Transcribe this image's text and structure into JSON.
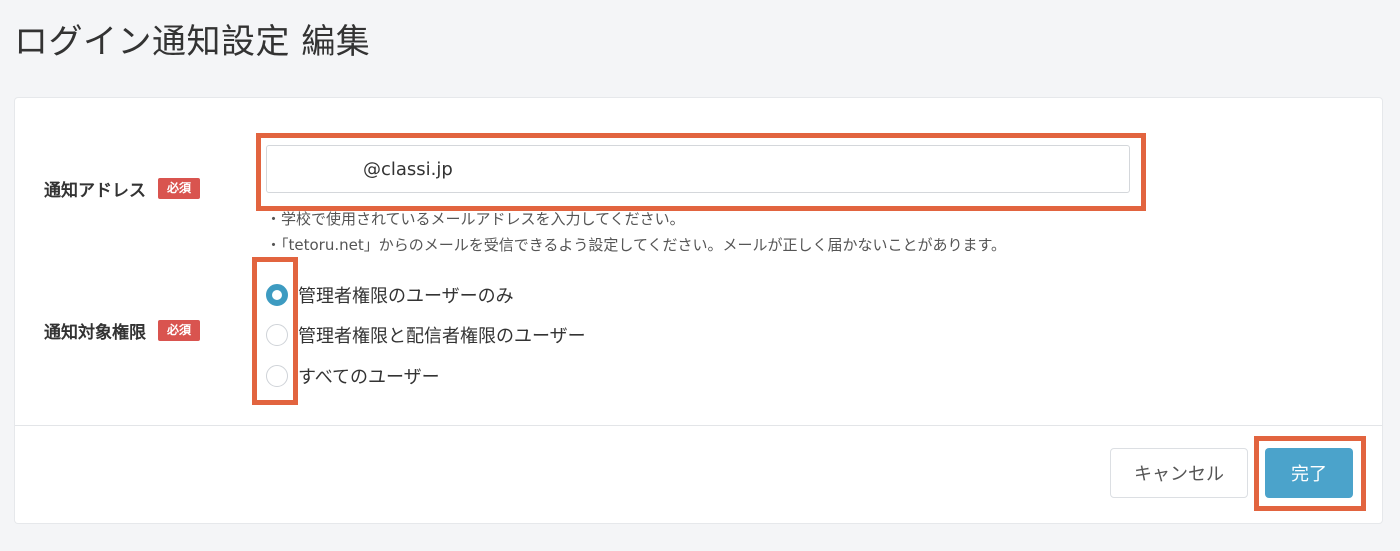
{
  "page": {
    "title": "ログイン通知設定 編集"
  },
  "form": {
    "address": {
      "label": "通知アドレス",
      "required_badge": "必須",
      "value": "@classi.jp",
      "help": [
        "・学校で使用されているメールアドレスを入力してください。",
        "・「tetoru.net」からのメールを受信できるよう設定してください。メールが正しく届かないことがあります。"
      ]
    },
    "target": {
      "label": "通知対象権限",
      "required_badge": "必須",
      "options": [
        {
          "label": "管理者権限のユーザーのみ",
          "checked": true
        },
        {
          "label": "管理者権限と配信者権限のユーザー",
          "checked": false
        },
        {
          "label": "すべてのユーザー",
          "checked": false
        }
      ]
    }
  },
  "actions": {
    "cancel_label": "キャンセル",
    "done_label": "完了"
  },
  "colors": {
    "accent": "#4ba3cb",
    "required": "#d9544f",
    "highlight": "#e2643f"
  }
}
